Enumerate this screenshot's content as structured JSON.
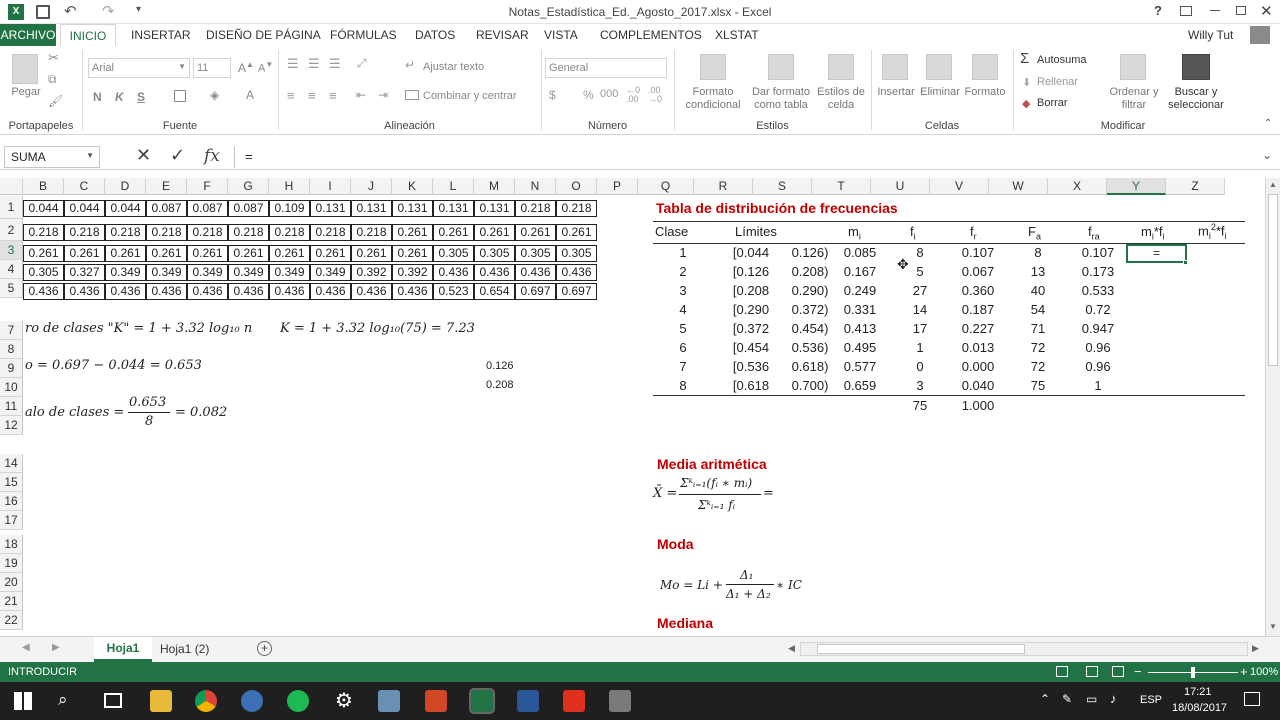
{
  "window": {
    "title": "Notas_Estadística_Ed._Agosto_2017.xlsx - Excel",
    "user": "Willy Tut"
  },
  "tabs": [
    "ARCHIVO",
    "INICIO",
    "INSERTAR",
    "DISEÑO DE PÁGINA",
    "FÓRMULAS",
    "DATOS",
    "REVISAR",
    "VISTA",
    "COMPLEMENTOS",
    "XLSTAT"
  ],
  "ribbon": {
    "pegar": "Pegar",
    "font_name": "Arial",
    "font_size": "11",
    "bold": "N",
    "italic": "K",
    "underline": "S",
    "ajustar_texto": "Ajustar texto",
    "combinar": "Combinar y centrar",
    "number_format": "General",
    "formato_condicional": "Formato condicional",
    "dar_formato": "Dar formato como tabla",
    "estilos_celda": "Estilos de celda",
    "insertar": "Insertar",
    "eliminar": "Eliminar",
    "formato": "Formato",
    "autosuma": "Autosuma",
    "rellenar": "Rellenar",
    "borrar": "Borrar",
    "ordenar": "Ordenar y filtrar",
    "buscar": "Buscar y seleccionar",
    "groups": [
      "Portapapeles",
      "Fuente",
      "Alineación",
      "Número",
      "Estilos",
      "Celdas",
      "Modificar"
    ]
  },
  "formula_bar": {
    "name_box": "SUMA",
    "fx": "fx",
    "content": "="
  },
  "columns": [
    "B",
    "C",
    "D",
    "E",
    "F",
    "G",
    "H",
    "I",
    "J",
    "K",
    "L",
    "M",
    "N",
    "O",
    "P",
    "Q",
    "R",
    "S",
    "T",
    "U",
    "V",
    "W",
    "X",
    "Y",
    "Z"
  ],
  "rows": [
    "1",
    "2",
    "3",
    "4",
    "5",
    "7",
    "8",
    "9",
    "10",
    "11",
    "12",
    "14",
    "15",
    "16",
    "17",
    "18",
    "19",
    "20",
    "21",
    "22"
  ],
  "data_grid": [
    [
      "0.044",
      "0.044",
      "0.044",
      "0.087",
      "0.087",
      "0.087",
      "0.109",
      "0.131",
      "0.131",
      "0.131",
      "0.131",
      "0.131",
      "0.218",
      "0.218"
    ],
    [
      "0.218",
      "0.218",
      "0.218",
      "0.218",
      "0.218",
      "0.218",
      "0.218",
      "0.218",
      "0.218",
      "0.261",
      "0.261",
      "0.261",
      "0.261",
      "0.261"
    ],
    [
      "0.261",
      "0.261",
      "0.261",
      "0.261",
      "0.261",
      "0.261",
      "0.261",
      "0.261",
      "0.261",
      "0.261",
      "0.305",
      "0.305",
      "0.305",
      "0.305"
    ],
    [
      "0.305",
      "0.327",
      "0.349",
      "0.349",
      "0.349",
      "0.349",
      "0.349",
      "0.349",
      "0.392",
      "0.392",
      "0.436",
      "0.436",
      "0.436",
      "0.436"
    ],
    [
      "0.436",
      "0.436",
      "0.436",
      "0.436",
      "0.436",
      "0.436",
      "0.436",
      "0.436",
      "0.436",
      "0.436",
      "0.523",
      "0.654",
      "0.697",
      "0.697"
    ]
  ],
  "formulas_left": {
    "row7a": "ro de clases \"K\" = 1 + 3.32 log₁₀ n",
    "row7b": "K = 1 + 3.32 log₁₀(75) = 7.23",
    "row9": "o = 0.697 − 0.044 = 0.653",
    "row11_pre": "alo de clases =",
    "row11_num": "0.653",
    "row11_den": "8",
    "row11_post": "= 0.082",
    "m9": "0.126",
    "m10": "0.208"
  },
  "freq_table": {
    "title": "Tabla de distribución de frecuencias",
    "headers": {
      "clase": "Clase",
      "limites": "Límites",
      "mi": "m",
      "fi": "f",
      "fr": "f",
      "Fa": "F",
      "fra": "f",
      "mifi": "m",
      "mi2fi": "m"
    },
    "header_subs": {
      "mi": "i",
      "fi": "i",
      "fr": "r",
      "Fa": "a",
      "fra": "ra",
      "mifi": "i",
      "mifi2": "*f",
      "mifi3": "i",
      "mi2fi": "i",
      "mi2sup": "2",
      "mi2fi2": "*f",
      "mi2fi3": "i"
    },
    "rows": [
      [
        "1",
        "[0.044",
        "0.126)",
        "0.085",
        "8",
        "0.107",
        "8",
        "0.107"
      ],
      [
        "2",
        "[0.126",
        "0.208)",
        "0.167",
        "5",
        "0.067",
        "13",
        "0.173"
      ],
      [
        "3",
        "[0.208",
        "0.290)",
        "0.249",
        "27",
        "0.360",
        "40",
        "0.533"
      ],
      [
        "4",
        "[0.290",
        "0.372)",
        "0.331",
        "14",
        "0.187",
        "54",
        "0.72"
      ],
      [
        "5",
        "[0.372",
        "0.454)",
        "0.413",
        "17",
        "0.227",
        "71",
        "0.947"
      ],
      [
        "6",
        "[0.454",
        "0.536)",
        "0.495",
        "1",
        "0.013",
        "72",
        "0.96"
      ],
      [
        "7",
        "[0.536",
        "0.618)",
        "0.577",
        "0",
        "0.000",
        "72",
        "0.96"
      ],
      [
        "8",
        "[0.618",
        "0.700)",
        "0.659",
        "3",
        "0.040",
        "75",
        "1"
      ]
    ],
    "total_fi": "75",
    "total_fr": "1.000",
    "editing": "="
  },
  "sections": {
    "media": "Media aritmética",
    "media_formula_lhs": "X̄ =",
    "media_num": "Σᵏᵢ₌₁(fᵢ ∗ mᵢ)",
    "media_den": "Σᵏᵢ₌₁ fᵢ",
    "media_eq": "=",
    "moda": "Moda",
    "moda_formula": "Mo = Li +",
    "moda_num": "Δ₁",
    "moda_den": "Δ₁ + Δ₂",
    "moda_post": "∗ IC",
    "mediana": "Mediana"
  },
  "sheets": [
    "Hoja1",
    "Hoja1 (2)"
  ],
  "status": {
    "mode": "INTRODUCIR",
    "zoom": "100%"
  },
  "taskbar": {
    "lang": "ESP",
    "time": "17:21",
    "date": "18/08/2017"
  }
}
